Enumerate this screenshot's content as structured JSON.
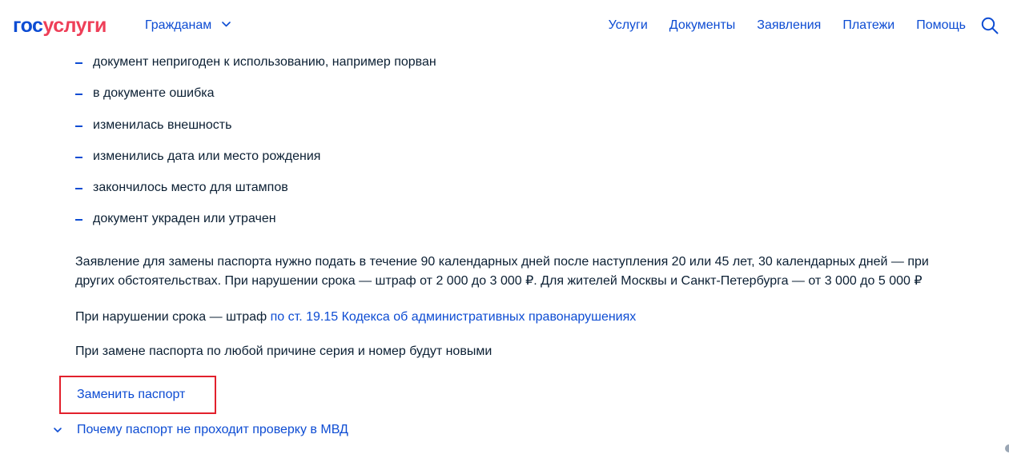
{
  "header": {
    "logo_part1": "гос",
    "logo_part2": "услуги",
    "audience": "Гражданам",
    "nav": [
      "Услуги",
      "Документы",
      "Заявления",
      "Платежи",
      "Помощь"
    ]
  },
  "content": {
    "reasons": [
      "документ непригоден к использованию, например порван",
      "в документе ошибка",
      "изменилась внешность",
      "изменились дата или место рождения",
      "закончилось место для штампов",
      "документ украден или утрачен"
    ],
    "deadline_line1": "Заявление для замены паспорта нужно подать в течение 90 календарных дней после наступления 20 или 45 лет, 30 календарных дней — при",
    "deadline_line2": "других обстоятельствах. При нарушении срока — штраф от 2 000 до 3 000 ₽. Для жителей Москвы и Санкт-Петербурга — от 3 000 до 5 000 ₽",
    "fine_text": "При нарушении срока — штраф ",
    "fine_link": "по ст. 19.15 Кодекса об административных правонарушениях",
    "series_text": "При замене паспорта по любой причине серия и номер будут новыми",
    "replace_link": "Заменить паспорт",
    "accordion_label": "Почему паспорт не проходит проверку в МВД"
  },
  "colors": {
    "brand_blue": "#0d4cd3",
    "brand_red": "#ee3f58",
    "highlight_border": "#e2202c",
    "text": "#0b1f33"
  },
  "icons": {
    "audience_chevron": "chevron-down-icon",
    "search": "search-icon",
    "accordion_chevron": "chevron-down-icon"
  }
}
